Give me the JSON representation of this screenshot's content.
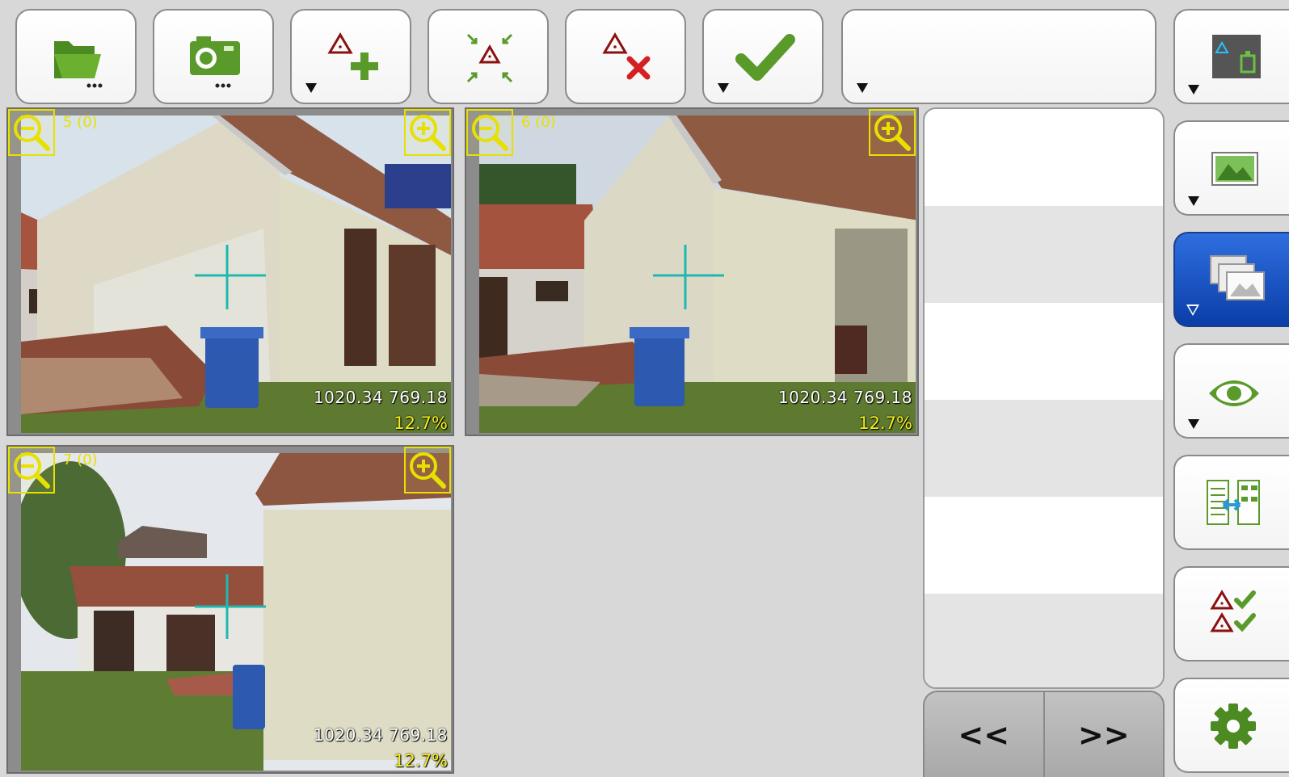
{
  "toolbar": {
    "buttons": [
      {
        "name": "open-folder-button",
        "icon": "folder-open-icon",
        "menu": false
      },
      {
        "name": "camera-button",
        "icon": "camera-icon",
        "menu": false
      },
      {
        "name": "add-point-button",
        "icon": "add-point-icon",
        "menu": true
      },
      {
        "name": "center-point-button",
        "icon": "collapse-point-icon",
        "menu": false
      },
      {
        "name": "delete-point-button",
        "icon": "delete-point-icon",
        "menu": false
      },
      {
        "name": "accept-button",
        "icon": "checkmark-icon",
        "menu": true
      }
    ],
    "search_value": ""
  },
  "viewers": [
    {
      "index_label": "5 (0)",
      "coords": "1020.34 769.18",
      "zoom": "12.7%"
    },
    {
      "index_label": "6 (0)",
      "coords": "1020.34 769.18",
      "zoom": "12.7%"
    },
    {
      "index_label": "7 (0)",
      "coords": "1020.34 769.18",
      "zoom": "12.7%"
    }
  ],
  "list": {
    "rows": [
      "",
      "",
      "",
      "",
      "",
      ""
    ]
  },
  "nav": {
    "prev_label": "<<",
    "next_label": ">>"
  },
  "right_panel": {
    "buttons": [
      {
        "name": "point-image-view-button",
        "icon": "point-on-image-icon",
        "menu": true
      },
      {
        "name": "image-button",
        "icon": "landscape-image-icon",
        "menu": true
      },
      {
        "name": "multi-image-button",
        "icon": "stacked-images-icon",
        "menu": true,
        "active": true
      },
      {
        "name": "visibility-button",
        "icon": "eye-icon",
        "menu": true
      },
      {
        "name": "compare-button",
        "icon": "compare-tables-icon",
        "menu": false
      },
      {
        "name": "validate-points-button",
        "icon": "validate-points-icon",
        "menu": false
      },
      {
        "name": "settings-button",
        "icon": "gear-icon",
        "menu": false
      }
    ]
  },
  "colors": {
    "accent_green": "#5a9a2a",
    "point_red": "#8b1010",
    "overlay_yellow": "#e8e000",
    "active_blue": "#1456c8",
    "crosshair": "#1fb8b0"
  }
}
